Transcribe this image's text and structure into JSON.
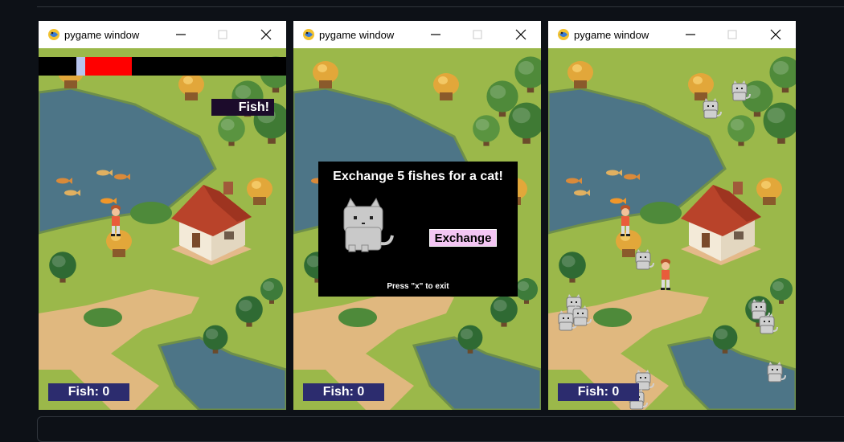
{
  "windows": [
    {
      "title": "pygame window",
      "fish_button_label": "Fish!",
      "fish_counter": "Fish: 0",
      "catch_meter": {
        "target_zone": "red",
        "marker": "light-blue"
      }
    },
    {
      "title": "pygame window",
      "fish_counter": "Fish: 0",
      "dialog": {
        "title": "Exchange 5 fishes for a cat!",
        "exchange_label": "Exchange",
        "hint": "Press \"x\" to exit"
      }
    },
    {
      "title": "pygame window",
      "fish_counter": "Fish: 0",
      "cats_visible": 11
    }
  ],
  "icons": {
    "app_icon": "pygame-snake-icon",
    "minimize": "minimize-icon",
    "maximize": "maximize-icon",
    "close": "close-icon"
  },
  "colors": {
    "grass": "#9bb84a",
    "water": "#4d7587",
    "path": "#e0b87f",
    "counter_bg": "#2c2c6e",
    "fish_button_bg": "#1c0b2b",
    "meter_red": "#ff0000",
    "exchange_bg": "#f4c6f4"
  }
}
